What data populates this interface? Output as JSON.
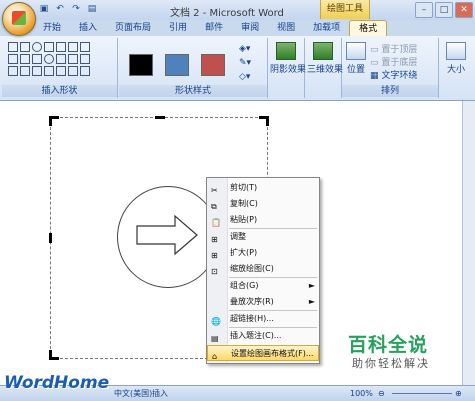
{
  "window": {
    "title": "文档 2 - Microsoft Word",
    "context_tool_label": "绘图工具",
    "buttons": [
      "–",
      "□",
      "✕"
    ]
  },
  "tabs": [
    {
      "label": "开始"
    },
    {
      "label": "插入"
    },
    {
      "label": "页面布局"
    },
    {
      "label": "引用"
    },
    {
      "label": "邮件"
    },
    {
      "label": "审阅"
    },
    {
      "label": "视图"
    },
    {
      "label": "加载项"
    },
    {
      "label": "格式"
    }
  ],
  "ribbon": {
    "insert_shapes_label": "插入形状",
    "shape_styles_label": "形状样式",
    "arrange_label": "排列",
    "shadow_label": "阴影效果",
    "3d_label": "三维效果",
    "position_label": "位置",
    "bring_front": "置于顶层",
    "send_back": "置于底层",
    "text_wrap": "文字环绕",
    "size_label": "大小",
    "swatch_colors": [
      "#000000",
      "#4f81bd",
      "#c0504d"
    ]
  },
  "context_menu": {
    "items": [
      {
        "label": "剪切(T)"
      },
      {
        "label": "复制(C)"
      },
      {
        "label": "粘贴(P)"
      },
      {
        "label": "调整"
      },
      {
        "label": "扩大(P)"
      },
      {
        "label": "缩放绘图(C)"
      },
      {
        "label": "组合(G)",
        "arrow": "►"
      },
      {
        "label": "叠放次序(R)",
        "arrow": "►"
      },
      {
        "label": "超链接(H)..."
      },
      {
        "label": "插入题注(C)..."
      },
      {
        "label": "设置绘图画布格式(F)..."
      }
    ]
  },
  "statusbar": {
    "language": "中文(美国)",
    "mode": "插入",
    "zoom": "100%"
  },
  "watermarks": {
    "wordhome": "WordHome",
    "baike": "百科全说",
    "baike_sub": "助你轻松解决"
  }
}
